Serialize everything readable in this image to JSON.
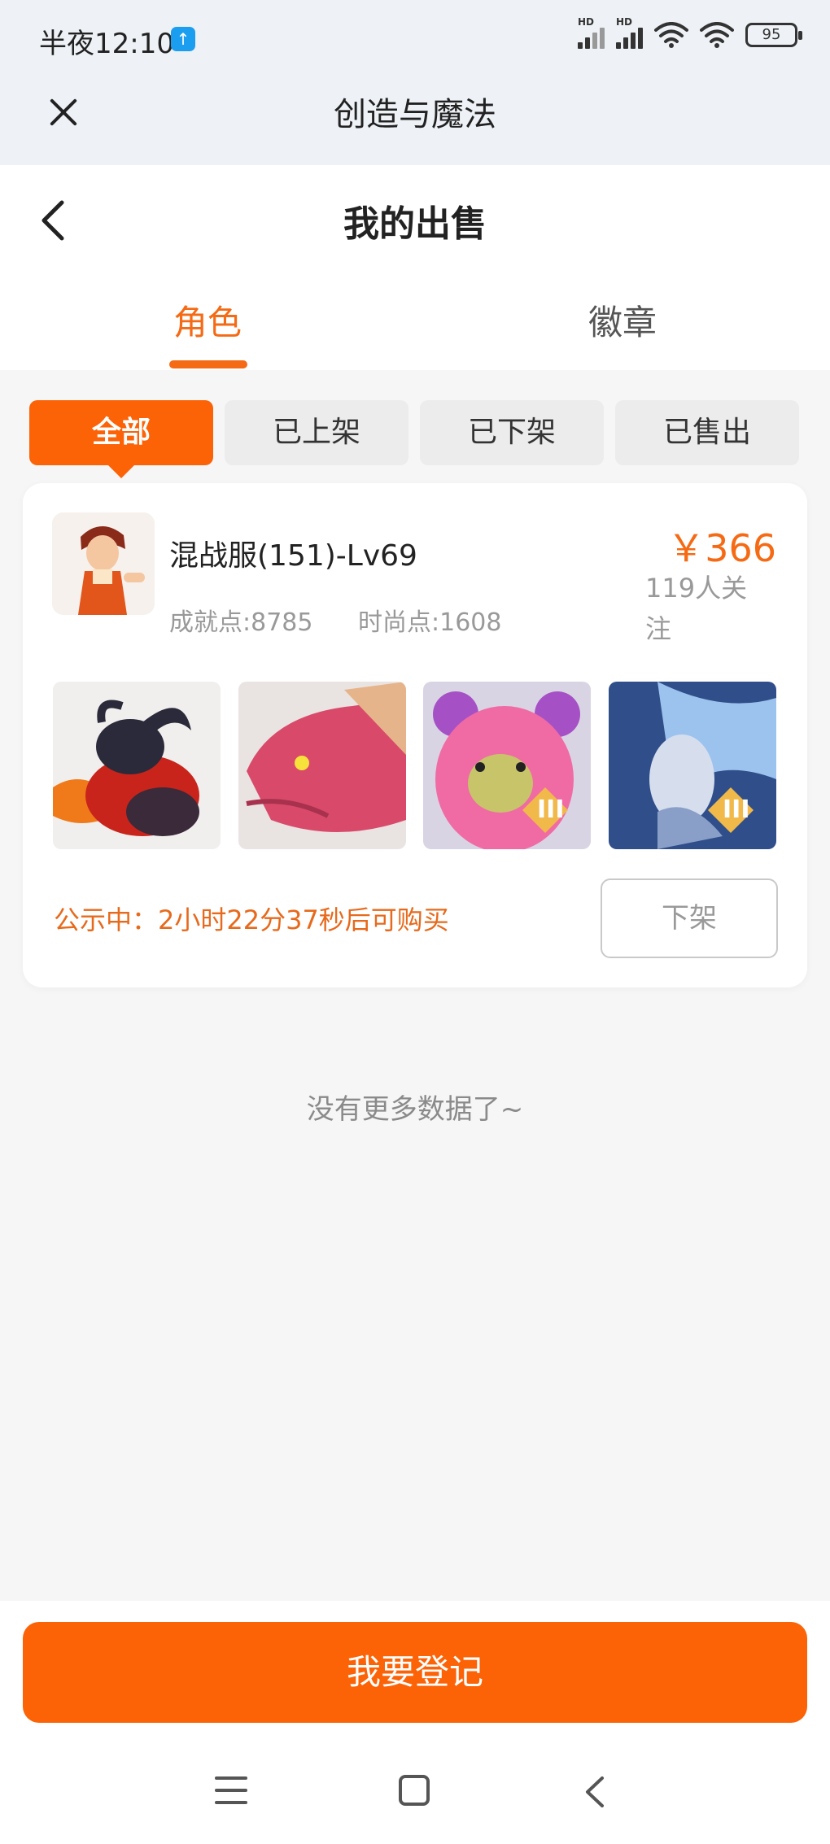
{
  "status_bar": {
    "time": "半夜12:10",
    "upload_badge_icon": "upload-arrow",
    "battery": "95"
  },
  "app_bar": {
    "title": "创造与魔法",
    "close_icon": "close-x"
  },
  "page": {
    "title": "我的出售",
    "back_icon": "chevron-left"
  },
  "tabs": [
    {
      "label": "角色",
      "active": true
    },
    {
      "label": "徽章",
      "active": false
    }
  ],
  "filters": [
    {
      "label": "全部",
      "active": true
    },
    {
      "label": "已上架",
      "active": false
    },
    {
      "label": "已下架",
      "active": false
    },
    {
      "label": "已售出",
      "active": false
    }
  ],
  "listing": {
    "name": "混战服(151)-Lv69",
    "achievement": "成就点:8785",
    "fashion": "时尚点:1608",
    "price": "￥366",
    "followers": "119人关注",
    "notice": "公示中：2小时22分37秒后可购买",
    "delist_label": "下架",
    "thumbnails": [
      "black-ram-mount",
      "pink-dragon-head",
      "pink-bear-pet",
      "ice-dragon-mount"
    ],
    "thumbnail_badges": [
      "",
      "",
      "III",
      "III"
    ]
  },
  "empty_text": "没有更多数据了~",
  "register_label": "我要登记",
  "colors": {
    "accent": "#fc6206",
    "accent_text": "#f56a14",
    "notice": "#e76a1c"
  }
}
